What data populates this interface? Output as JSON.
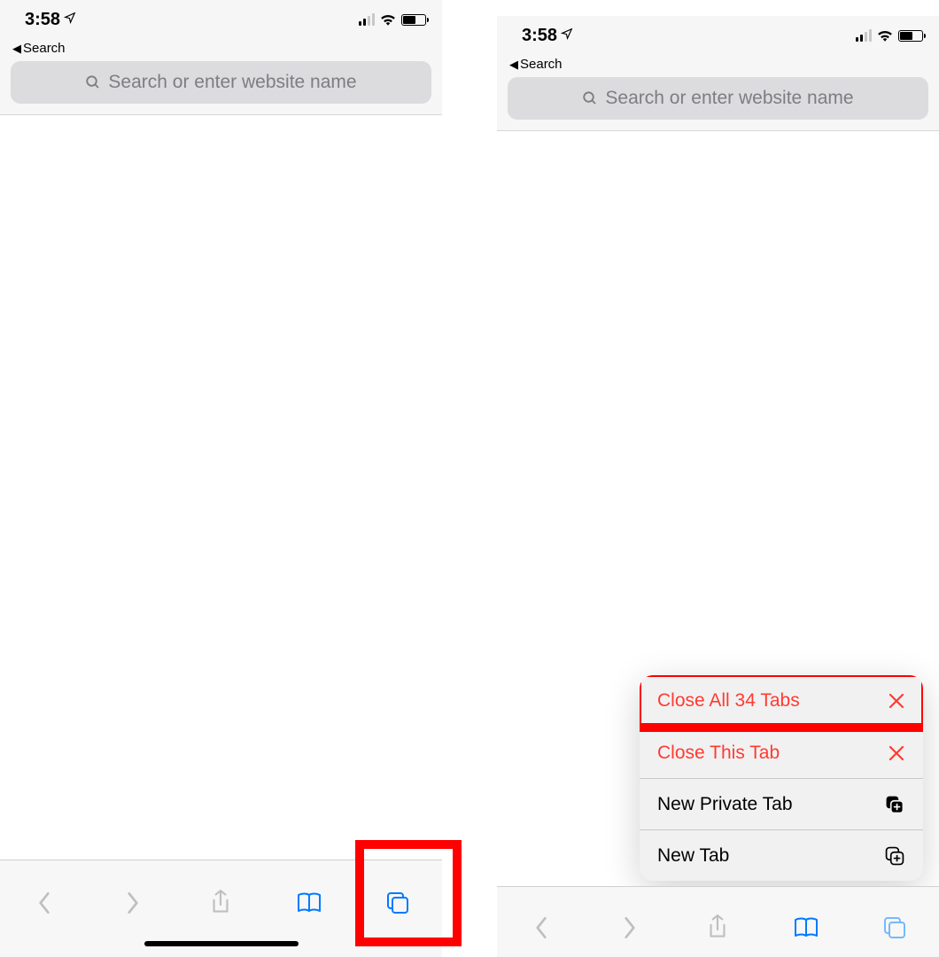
{
  "status": {
    "time": "3:58",
    "back_label": "Search"
  },
  "addressbar": {
    "placeholder": "Search or enter website name"
  },
  "menu": {
    "close_all": "Close All 34 Tabs",
    "close_this": "Close This Tab",
    "new_private": "New Private Tab",
    "new_tab": "New Tab"
  }
}
